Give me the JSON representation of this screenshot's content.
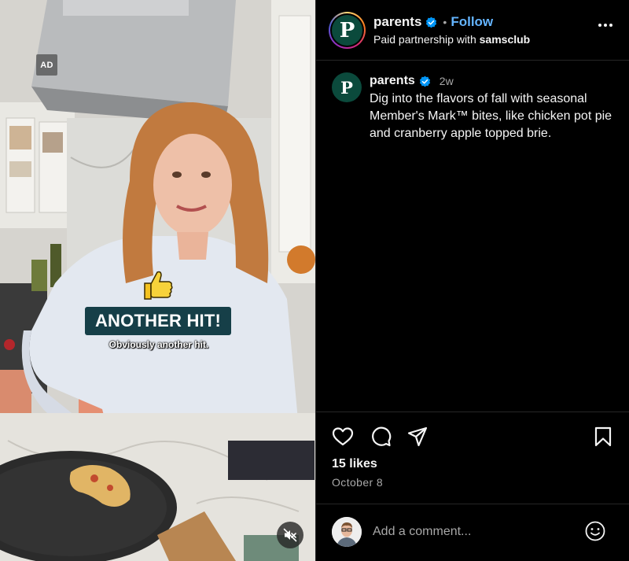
{
  "media": {
    "ad_label": "AD",
    "caption_title": "ANOTHER HIT!",
    "caption_subtitle": "Obviously another hit.",
    "mute_icon": "speaker-muted-icon",
    "thumbs_icon": "thumbs-up-icon"
  },
  "header": {
    "username": "parents",
    "verified_icon": "verified-badge-icon",
    "separator": "•",
    "follow_label": "Follow",
    "partnership_prefix": "Paid partnership with ",
    "partner_name": "samsclub",
    "logo_letter": "P",
    "more_icon": "more-options-icon"
  },
  "post": {
    "username": "parents",
    "time_ago": "2w",
    "logo_letter": "P",
    "caption": "Dig into the flavors of fall with seasonal Member's Mark™ bites, like chicken pot pie and cranberry apple topped brie."
  },
  "actions": {
    "like_icon": "heart-icon",
    "comment_icon": "comment-icon",
    "share_icon": "share-icon",
    "save_icon": "bookmark-icon"
  },
  "stats": {
    "likes": "15 likes",
    "date": "October 8"
  },
  "comment": {
    "placeholder": "Add a comment...",
    "emoji_icon": "emoji-icon"
  },
  "colors": {
    "follow": "#64b4ff",
    "verified": "#0095f6",
    "caption_box": "#163f48",
    "brand_green": "#0b4a3c"
  }
}
